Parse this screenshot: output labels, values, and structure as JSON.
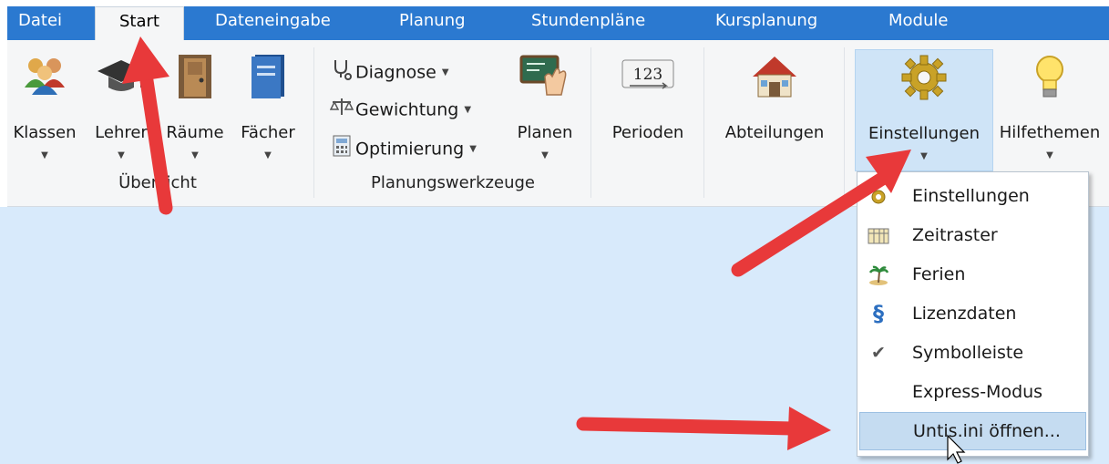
{
  "tabs": [
    {
      "label": "Datei",
      "active": false
    },
    {
      "label": "Start",
      "active": true
    },
    {
      "label": "Dateneingabe",
      "active": false
    },
    {
      "label": "Planung",
      "active": false
    },
    {
      "label": "Stundenpläne",
      "active": false
    },
    {
      "label": "Kursplanung",
      "active": false
    },
    {
      "label": "Module",
      "active": false
    }
  ],
  "ribbon": {
    "uebersicht": {
      "group_label": "Übersicht",
      "klassen": "Klassen",
      "lehrer": "Lehrer",
      "raeume": "Räume",
      "faecher": "Fächer"
    },
    "werkzeuge": {
      "group_label": "Planungswerkzeuge",
      "diagnose": "Diagnose",
      "gewichtung": "Gewichtung",
      "optimierung": "Optimierung",
      "planen": "Planen"
    },
    "perioden": "Perioden",
    "abteilungen": "Abteilungen",
    "einstellungen": "Einstellungen",
    "hilfethemen": "Hilfethemen",
    "perioden_icon_text": "123"
  },
  "menu": {
    "items": [
      {
        "label": "Einstellungen",
        "icon": "gear-icon"
      },
      {
        "label": "Zeitraster",
        "icon": "timetable-grid-icon"
      },
      {
        "label": "Ferien",
        "icon": "palm-island-icon"
      },
      {
        "label": "Lizenzdaten",
        "icon": "paragraph-icon"
      },
      {
        "label": "Symbolleiste",
        "icon": "checkmark-icon",
        "checked": true
      },
      {
        "label": "Express-Modus",
        "icon": ""
      },
      {
        "label": "Untis.ini öffnen...",
        "icon": "",
        "hovered": true
      }
    ]
  },
  "colors": {
    "tabbar": "#2b79d0",
    "ribbon": "#f5f6f7",
    "content": "#d8eafb",
    "highlight": "#cfe4f7",
    "annotation_arrow": "#e8393a"
  }
}
